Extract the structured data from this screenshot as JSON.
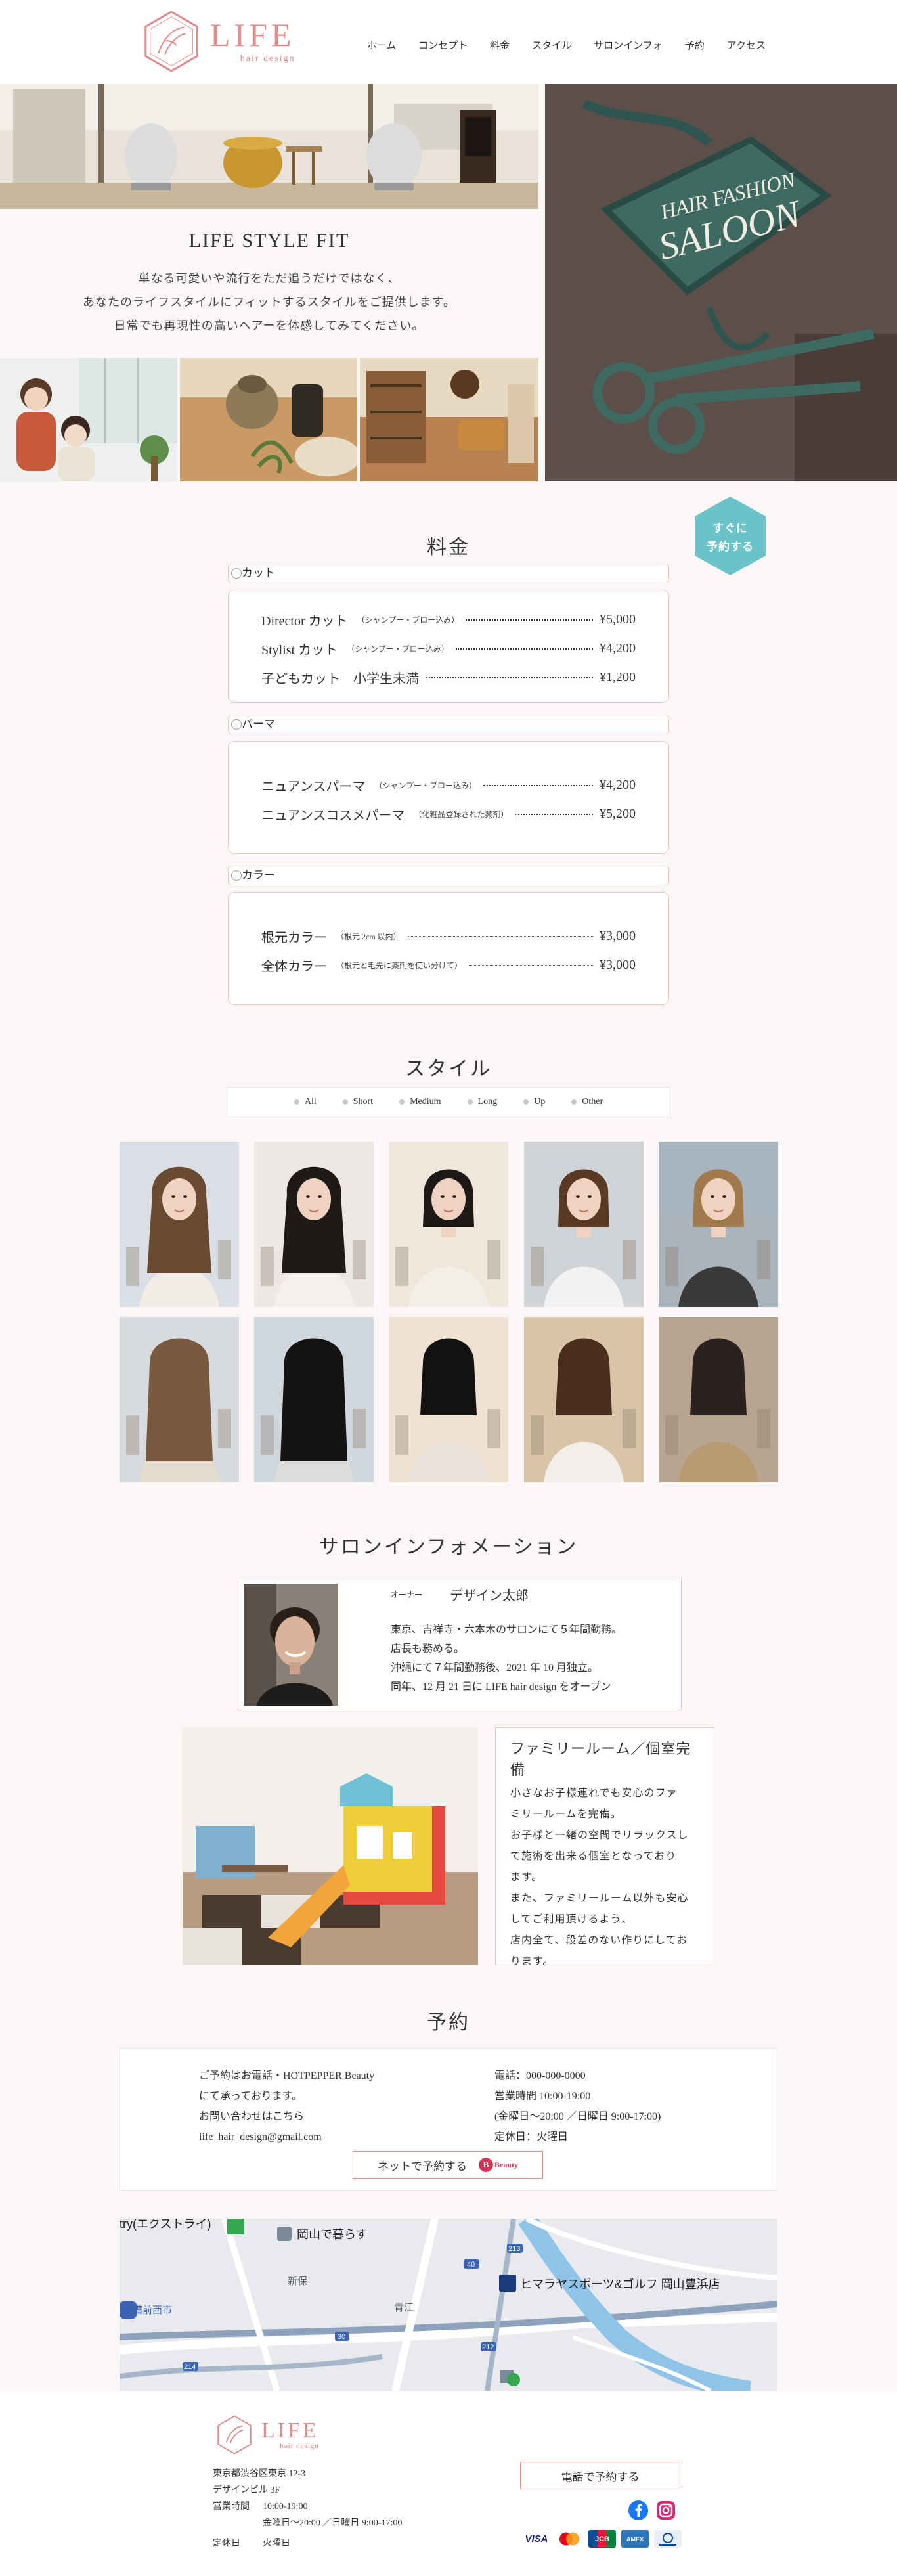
{
  "header": {
    "logo_main": "LIFE",
    "logo_sub": "hair design",
    "nav": [
      "ホーム",
      "コンセプト",
      "料金",
      "スタイル",
      "サロンインフォ",
      "予約",
      "アクセス"
    ]
  },
  "hero": {
    "title": "LIFE STYLE FIT",
    "lines": [
      "単なる可愛いや流行をただ追うだけではなく、",
      "あなたのライフスタイルにフィットするスタイルをご提供します。",
      "日常でも再現性の高いヘアーを体感してみてください。"
    ],
    "sign_text": [
      "HAIR FASHION",
      "SALOON"
    ]
  },
  "reserve_badge": {
    "line1": "すぐに",
    "line2": "予約する"
  },
  "price": {
    "title": "料金",
    "categories": [
      {
        "label": "カット",
        "items": [
          {
            "name": "Director カット",
            "note": "（シャンプー・ブロー込み）",
            "price": "¥5,000"
          },
          {
            "name": "Stylist カット",
            "note": "（シャンプー・ブロー込み）",
            "price": "¥4,200"
          },
          {
            "name": "子どもカット　小学生未満",
            "note": "",
            "price": "¥1,200"
          }
        ]
      },
      {
        "label": "パーマ",
        "items": [
          {
            "name": "ニュアンスパーマ",
            "note": "（シャンプー・ブロー込み）",
            "price": "¥4,200"
          },
          {
            "name": "ニュアンスコスメパーマ",
            "note": "（化粧品登録された薬剤）",
            "price": "¥5,200"
          }
        ]
      },
      {
        "label": "カラー",
        "items": [
          {
            "name": "根元カラー",
            "note": "（根元 2cm 以内）",
            "price": "¥3,000"
          },
          {
            "name": "全体カラー",
            "note": "（根元と毛先に薬剤を使い分けて）",
            "price": "¥3,000"
          }
        ]
      }
    ]
  },
  "style": {
    "title": "スタイル",
    "filters": [
      "All",
      "Short",
      "Medium",
      "Long",
      "Up",
      "Other"
    ]
  },
  "salon": {
    "title": "サロンインフォメーション",
    "owner_role": "オーナー",
    "owner_name": "デザイン太郎",
    "owner_bio": [
      "東京、吉祥寺・六本木のサロンにて５年間勤務。",
      "店長も務める。",
      "沖縄にて７年間勤務後、2021 年 10 月独立。",
      "同年、12 月 21 日に LIFE hair design をオープン"
    ],
    "family_title": "ファミリールーム／個室完備",
    "family_lines": [
      "小さなお子様連れでも安心のファ",
      "ミリールームを完備。",
      "お子様と一緒の空間でリラックスし",
      "て施術を出来る個室となっており",
      "ます。",
      "また、ファミリールーム以外も安心",
      "してご利用頂けるよう、",
      "店内全て、段差のない作りにしてお",
      "ります。"
    ]
  },
  "reservation": {
    "title": "予約",
    "left_lines": [
      "ご予約はお電話・HOTPEPPER Beauty",
      "にて承っております。",
      "お問い合わせはこちら",
      "life_hair_design@gmail.com"
    ],
    "right_lines": [
      "電話：000-000-0000",
      "営業時間 10:00-19:00",
      "(金曜日～20:00 ／日曜日 9:00-17:00)",
      "定休日：火曜日"
    ],
    "net_button": "ネットで予約する",
    "beauty_logo": "Beauty"
  },
  "map": {
    "labels": [
      "try(エクストライ)",
      "岡山で暮らす",
      "ヒマラヤスポーツ&ゴルフ 岡山豊浜店",
      "備前西市",
      "新保",
      "青江",
      "213",
      "212",
      "214",
      "30",
      "40"
    ]
  },
  "footer": {
    "logo_main": "LIFE",
    "logo_sub": "hair design",
    "address": "東京都渋谷区東京 12-3",
    "building": "デザインビル 3F",
    "hours_label": "営業時間",
    "hours": "10:00-19:00",
    "hours_note": "金曜日～20:00 ／日曜日 9:00-17:00",
    "closed_label": "定休日",
    "closed": "火曜日",
    "call_button": "電話で予約する",
    "cards": [
      "VISA",
      "JCB",
      "AMEX"
    ]
  },
  "colors": {
    "accent": "#e28b8b",
    "teal": "#6bc3c9",
    "bg": "#fcf7f7"
  }
}
